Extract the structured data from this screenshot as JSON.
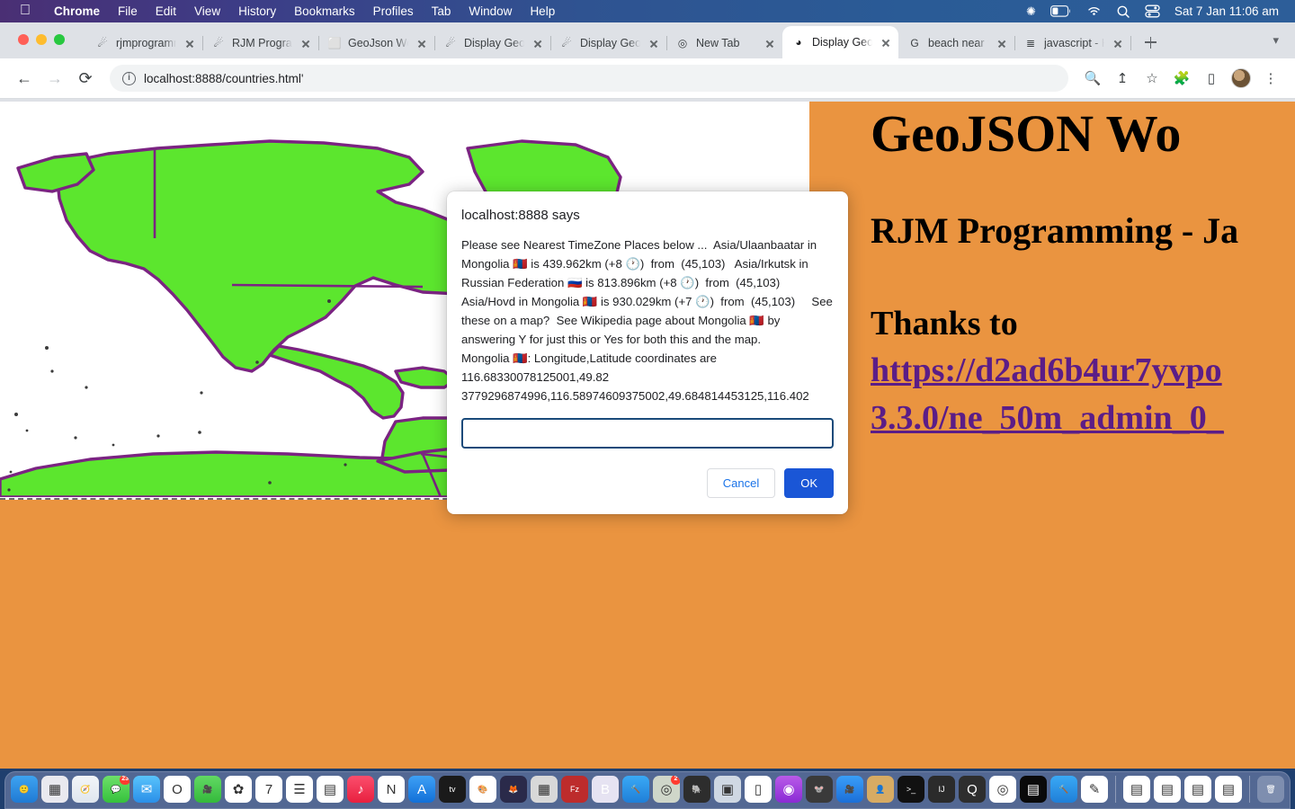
{
  "menubar": {
    "apple_icon": "apple-logo",
    "items": [
      {
        "label": "Chrome",
        "bold": true
      },
      {
        "label": "File",
        "bold": false
      },
      {
        "label": "Edit",
        "bold": false
      },
      {
        "label": "View",
        "bold": false
      },
      {
        "label": "History",
        "bold": false
      },
      {
        "label": "Bookmarks",
        "bold": false
      },
      {
        "label": "Profiles",
        "bold": false
      },
      {
        "label": "Tab",
        "bold": false
      },
      {
        "label": "Window",
        "bold": false
      },
      {
        "label": "Help",
        "bold": false
      }
    ],
    "status": {
      "bluetooth_icon": "bluetooth-icon",
      "battery_icon": "battery-icon",
      "wifi_icon": "wifi-icon",
      "search_icon": "spotlight-search-icon",
      "control_center_icon": "control-center-icon",
      "clock": "Sat 7 Jan  11:06 am"
    }
  },
  "browser": {
    "tabs": [
      {
        "title": "rjmprogramming",
        "favicon": "comet-icon",
        "active": false
      },
      {
        "title": "RJM Programming",
        "favicon": "comet-icon",
        "active": false
      },
      {
        "title": "GeoJson World",
        "favicon": "blank-page-icon",
        "active": false
      },
      {
        "title": "Display Geo.",
        "favicon": "comet-icon",
        "active": false
      },
      {
        "title": "Display Geo.",
        "favicon": "comet-icon",
        "active": false
      },
      {
        "title": "New Tab",
        "favicon": "chrome-icon",
        "active": false
      },
      {
        "title": "Display Geo.",
        "favicon": "globe-dark-icon",
        "active": true
      },
      {
        "title": "beach near t",
        "favicon": "google-g-icon",
        "active": false
      },
      {
        "title": "javascript - H",
        "favicon": "stackoverflow-icon",
        "active": false
      }
    ],
    "new_tab_label": "+",
    "tab_list_chevron": "chevron-down-icon",
    "toolbar": {
      "back_icon": "back-arrow-icon",
      "forward_icon": "forward-arrow-icon",
      "reload_icon": "reload-icon",
      "site_info_icon": "info-circle-icon",
      "url": "localhost:8888/countries.html'",
      "zoom_icon": "zoom-in-icon",
      "share_icon": "share-icon",
      "bookmark_icon": "star-icon",
      "extensions_icon": "puzzle-piece-icon",
      "sidepanel_icon": "side-panel-icon",
      "profile_icon": "avatar",
      "menu_icon": "three-dot-menu-icon"
    }
  },
  "dialog": {
    "title": "localhost:8888 says",
    "message": "Please see Nearest TimeZone Places below ...  Asia/Ulaanbaatar in Mongolia 🇲🇳 is 439.962km (+8 🕐)  from  (45,103)   Asia/Irkutsk in Russian Federation 🇷🇺 is 813.896km (+8 🕐)  from  (45,103)   Asia/Hovd in Mongolia 🇲🇳 is 930.029km (+7 🕐)  from  (45,103)     See these on a map?  See Wikipedia page about Mongolia 🇲🇳 by answering Y for just this or Yes for both this and the map.\nMongolia 🇲🇳: Longitude,Latitude coordinates are 116.68330078125001,49.82 3779296874996,116.58974609375002,49.684814453125,116.402",
    "input_value": "",
    "input_placeholder": "",
    "cancel_label": "Cancel",
    "ok_label": "OK"
  },
  "page": {
    "background_color": "#ea9440",
    "map": {
      "land_fill": "#5ce62e",
      "land_stroke": "#7b2382",
      "ocean_fill": "#ffffff",
      "border_style": "dashed"
    },
    "heading": "GeoJSON Wo",
    "subheading": "RJM Programming - Ja",
    "thanks_label": "Thanks to",
    "thanks_url": "https://d2ad6b4ur7yvpo\n3.3.0/ne_50m_admin_0_",
    "link_color": "#5b1d87"
  },
  "dock": {
    "items": [
      {
        "name": "finder",
        "glyph": "🙂",
        "bg": "linear-gradient(180deg,#3ea3f0,#1f7ad4)",
        "running": true,
        "badge": ""
      },
      {
        "name": "launchpad",
        "glyph": "▦",
        "bg": "#e9e9ef",
        "running": false,
        "badge": ""
      },
      {
        "name": "safari",
        "glyph": "🧭",
        "bg": "linear-gradient(180deg,#f2f5f8,#dfe6ee)",
        "running": true,
        "badge": ""
      },
      {
        "name": "messages",
        "glyph": "💬",
        "bg": "linear-gradient(180deg,#6ee06a,#35c13c)",
        "running": false,
        "badge": "23"
      },
      {
        "name": "mail",
        "glyph": "✉",
        "bg": "linear-gradient(180deg,#59c3fb,#2a8fe8)",
        "running": false,
        "badge": ""
      },
      {
        "name": "opera",
        "glyph": "O",
        "bg": "#ffffff",
        "running": false,
        "badge": ""
      },
      {
        "name": "facetime",
        "glyph": "🎥",
        "bg": "linear-gradient(180deg,#62d964,#34b93b)",
        "running": false,
        "badge": ""
      },
      {
        "name": "photos",
        "glyph": "✿",
        "bg": "#ffffff",
        "running": false,
        "badge": ""
      },
      {
        "name": "calendar",
        "glyph": "7",
        "bg": "#ffffff",
        "running": false,
        "badge": ""
      },
      {
        "name": "reminders",
        "glyph": "☰",
        "bg": "#ffffff",
        "running": false,
        "badge": ""
      },
      {
        "name": "notes",
        "glyph": "▤",
        "bg": "#ffffff",
        "running": false,
        "badge": ""
      },
      {
        "name": "music",
        "glyph": "♪",
        "bg": "linear-gradient(180deg,#fb4e6d,#e8203f)",
        "running": false,
        "badge": ""
      },
      {
        "name": "news",
        "glyph": "N",
        "bg": "#ffffff",
        "running": false,
        "badge": ""
      },
      {
        "name": "app-store",
        "glyph": "A",
        "bg": "linear-gradient(180deg,#3ea0f5,#1270d8)",
        "running": false,
        "badge": ""
      },
      {
        "name": "apple-tv",
        "glyph": "tv",
        "bg": "#1a1a1a",
        "running": false,
        "badge": ""
      },
      {
        "name": "preview",
        "glyph": "🎨",
        "bg": "#ffffff",
        "running": false,
        "badge": ""
      },
      {
        "name": "firefox",
        "glyph": "🦊",
        "bg": "#2a2a4a",
        "running": false,
        "badge": ""
      },
      {
        "name": "calculator",
        "glyph": "▦",
        "bg": "#d8d8d8",
        "running": false,
        "badge": ""
      },
      {
        "name": "filezilla",
        "glyph": "Fz",
        "bg": "#bd2c2c",
        "running": true,
        "badge": ""
      },
      {
        "name": "bbedit",
        "glyph": "B",
        "bg": "#e6e3f2",
        "running": true,
        "badge": ""
      },
      {
        "name": "xcode",
        "glyph": "🔨",
        "bg": "linear-gradient(180deg,#3aa9f5,#1f7fd8)",
        "running": false,
        "badge": ""
      },
      {
        "name": "sequel-pro",
        "glyph": "◎",
        "bg": "#cfd6c9",
        "running": false,
        "badge": "2"
      },
      {
        "name": "postgresql",
        "glyph": "🐘",
        "bg": "#2d2d2d",
        "running": true,
        "badge": ""
      },
      {
        "name": "disk-utility",
        "glyph": "▣",
        "bg": "#cfd8e3",
        "running": false,
        "badge": ""
      },
      {
        "name": "pages",
        "glyph": "▯",
        "bg": "#ffffff",
        "running": false,
        "badge": ""
      },
      {
        "name": "podcasts",
        "glyph": "◉",
        "bg": "linear-gradient(180deg,#b95ae8,#8a2bd4)",
        "running": false,
        "badge": ""
      },
      {
        "name": "gimp",
        "glyph": "🐭",
        "bg": "#3a3a3a",
        "running": false,
        "badge": ""
      },
      {
        "name": "zoom",
        "glyph": "🎥",
        "bg": "linear-gradient(180deg,#3a9ef8,#1b6fd8)",
        "running": false,
        "badge": ""
      },
      {
        "name": "contacts",
        "glyph": "👤",
        "bg": "#d7ab63",
        "running": false,
        "badge": ""
      },
      {
        "name": "terminal",
        "glyph": ">_",
        "bg": "#111111",
        "running": true,
        "badge": ""
      },
      {
        "name": "intellij-idea",
        "glyph": "IJ",
        "bg": "#2b2b2b",
        "running": false,
        "badge": ""
      },
      {
        "name": "quicktime",
        "glyph": "Q",
        "bg": "#2e2e2e",
        "running": false,
        "badge": ""
      },
      {
        "name": "google-chrome",
        "glyph": "◎",
        "bg": "#ffffff",
        "running": true,
        "badge": ""
      },
      {
        "name": "terminal-2",
        "glyph": "▤",
        "bg": "#0a0a0a",
        "running": false,
        "badge": ""
      },
      {
        "name": "xcode-2",
        "glyph": "🔨",
        "bg": "linear-gradient(180deg,#3aa9f5,#1f7fd8)",
        "running": false,
        "badge": ""
      },
      {
        "name": "textedit",
        "glyph": "✎",
        "bg": "#ffffff",
        "running": false,
        "badge": ""
      },
      {
        "name": "minimized-window-1",
        "glyph": "▤",
        "bg": "#ffffff",
        "running": false,
        "badge": ""
      },
      {
        "name": "minimized-window-2",
        "glyph": "▤",
        "bg": "#ffffff",
        "running": false,
        "badge": ""
      },
      {
        "name": "minimized-window-3",
        "glyph": "▤",
        "bg": "#ffffff",
        "running": false,
        "badge": ""
      },
      {
        "name": "minimized-window-4",
        "glyph": "▤",
        "bg": "#ffffff",
        "running": false,
        "badge": ""
      },
      {
        "name": "trash",
        "glyph": "🗑",
        "bg": "rgba(255,255,255,.25)",
        "running": false,
        "badge": ""
      }
    ]
  }
}
